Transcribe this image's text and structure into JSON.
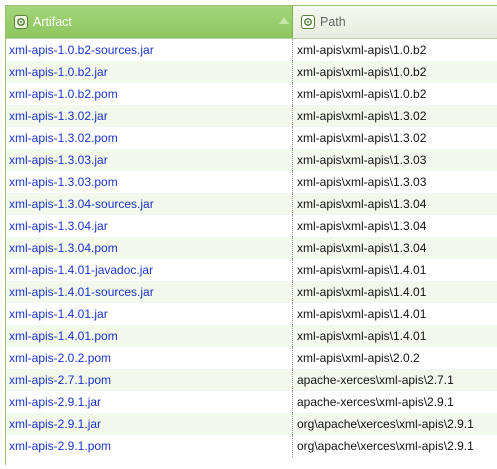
{
  "header": {
    "artifact_label": "Artifact",
    "path_label": "Path",
    "artifact_icon": "gear-icon",
    "path_icon": "gear-icon",
    "sort": "ascending"
  },
  "rows": [
    {
      "artifact": "xml-apis-1.0.b2-sources.jar",
      "path": "xml-apis\\xml-apis\\1.0.b2"
    },
    {
      "artifact": "xml-apis-1.0.b2.jar",
      "path": "xml-apis\\xml-apis\\1.0.b2"
    },
    {
      "artifact": "xml-apis-1.0.b2.pom",
      "path": "xml-apis\\xml-apis\\1.0.b2"
    },
    {
      "artifact": "xml-apis-1.3.02.jar",
      "path": "xml-apis\\xml-apis\\1.3.02"
    },
    {
      "artifact": "xml-apis-1.3.02.pom",
      "path": "xml-apis\\xml-apis\\1.3.02"
    },
    {
      "artifact": "xml-apis-1.3.03.jar",
      "path": "xml-apis\\xml-apis\\1.3.03"
    },
    {
      "artifact": "xml-apis-1.3.03.pom",
      "path": "xml-apis\\xml-apis\\1.3.03"
    },
    {
      "artifact": "xml-apis-1.3.04-sources.jar",
      "path": "xml-apis\\xml-apis\\1.3.04"
    },
    {
      "artifact": "xml-apis-1.3.04.jar",
      "path": "xml-apis\\xml-apis\\1.3.04"
    },
    {
      "artifact": "xml-apis-1.3.04.pom",
      "path": "xml-apis\\xml-apis\\1.3.04"
    },
    {
      "artifact": "xml-apis-1.4.01-javadoc.jar",
      "path": "xml-apis\\xml-apis\\1.4.01"
    },
    {
      "artifact": "xml-apis-1.4.01-sources.jar",
      "path": "xml-apis\\xml-apis\\1.4.01"
    },
    {
      "artifact": "xml-apis-1.4.01.jar",
      "path": "xml-apis\\xml-apis\\1.4.01"
    },
    {
      "artifact": "xml-apis-1.4.01.pom",
      "path": "xml-apis\\xml-apis\\1.4.01"
    },
    {
      "artifact": "xml-apis-2.0.2.pom",
      "path": "xml-apis\\xml-apis\\2.0.2"
    },
    {
      "artifact": "xml-apis-2.7.1.pom",
      "path": "apache-xerces\\xml-apis\\2.7.1"
    },
    {
      "artifact": "xml-apis-2.9.1.jar",
      "path": "apache-xerces\\xml-apis\\2.9.1"
    },
    {
      "artifact": "xml-apis-2.9.1.jar",
      "path": "org\\apache\\xerces\\xml-apis\\2.9.1"
    },
    {
      "artifact": "xml-apis-2.9.1.pom",
      "path": "org\\apache\\xerces\\xml-apis\\2.9.1"
    }
  ],
  "colors": {
    "header_active": "#8dc65e",
    "artifact_text": "#1a33cc",
    "row_alt": "#f3f8ec"
  }
}
